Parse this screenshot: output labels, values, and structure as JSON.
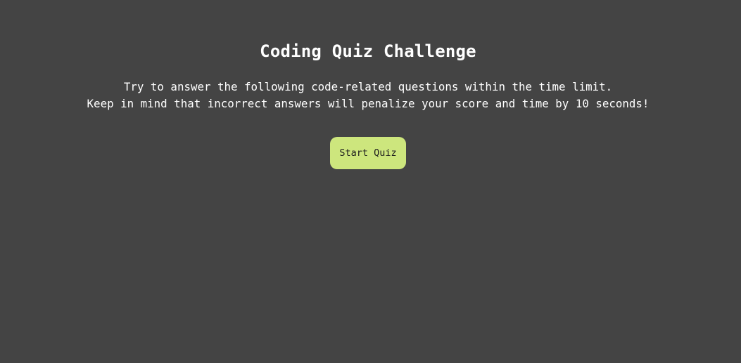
{
  "quiz": {
    "title": "Coding Quiz Challenge",
    "intro_line_1": "Try to answer the following code-related questions within the time limit.",
    "intro_line_2": "Keep in mind that incorrect answers will penalize your score and time by 10 seconds!",
    "start_button_label": "Start Quiz"
  },
  "colors": {
    "background": "#444444",
    "text": "#ffffff",
    "button_background": "#cde67d",
    "button_text": "#1e1e1e"
  }
}
